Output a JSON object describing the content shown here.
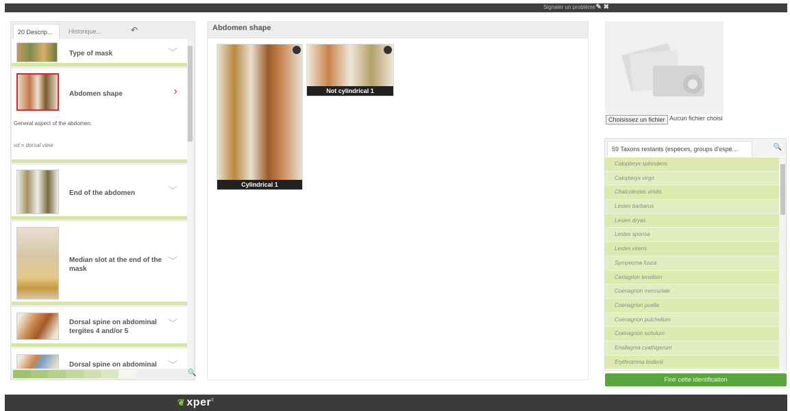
{
  "topbar": {
    "report_label": "Signaler un problème",
    "tools_glyph": "✎ ✖"
  },
  "left_panel": {
    "tab_descriptors": "20 Descrip...",
    "tab_history": "Historique...",
    "undo_glyph": "↶",
    "descriptors": [
      {
        "label": "Type of mask",
        "chevron": "﹀"
      },
      {
        "label": "Abdomen shape",
        "chevron": "›",
        "extra_desc": "General aspect of the abdomen.",
        "extra_note": "vd = dorsal view"
      },
      {
        "label": "End of the abdomen",
        "chevron": "﹀"
      },
      {
        "label": "Median slot at the end of the mask",
        "chevron": "﹀"
      },
      {
        "label": "Dorsal spine on abdominal tergites 4 and/or 5",
        "chevron": "﹀"
      },
      {
        "label": "Dorsal spine on abdominal",
        "chevron": "﹀"
      }
    ],
    "search_glyph": "🔍",
    "swatch_colors": [
      "#9ec36a",
      "#a9cb79",
      "#b5d28a",
      "#c1d99b",
      "#cde1ad",
      "#dae8c1",
      "#f4f7ed"
    ]
  },
  "center_panel": {
    "title": "Abdomen shape",
    "states": [
      {
        "caption": "Cylindrical 1"
      },
      {
        "caption": "Not cylindrical 1"
      }
    ]
  },
  "upload": {
    "button_label": "Choisissez un fichier",
    "status": "Aucun fichier choisi"
  },
  "taxa": {
    "header": "59 Taxons restants (espèces, groups d'espè...",
    "search_glyph": "🔍",
    "items": [
      "Calopteryx splendens",
      "Calopteryx virgo",
      "Chalcolestes viridis",
      "Lestes barbarus",
      "Lestes dryas",
      "Lestes sponsa",
      "Lestes virens",
      "Sympecma fusca",
      "Ceriagrion tenellum",
      "Coenagrion mercuriale",
      "Coenagrion puella",
      "Coenagrion pulchellum",
      "Coenagrion scitulum",
      "Enallagma cyathigerum",
      "Erythromma lindenii"
    ],
    "finish_label": "Finir cette identification"
  },
  "footer": {
    "logo_text": "xper",
    "logo_sup": "3"
  }
}
